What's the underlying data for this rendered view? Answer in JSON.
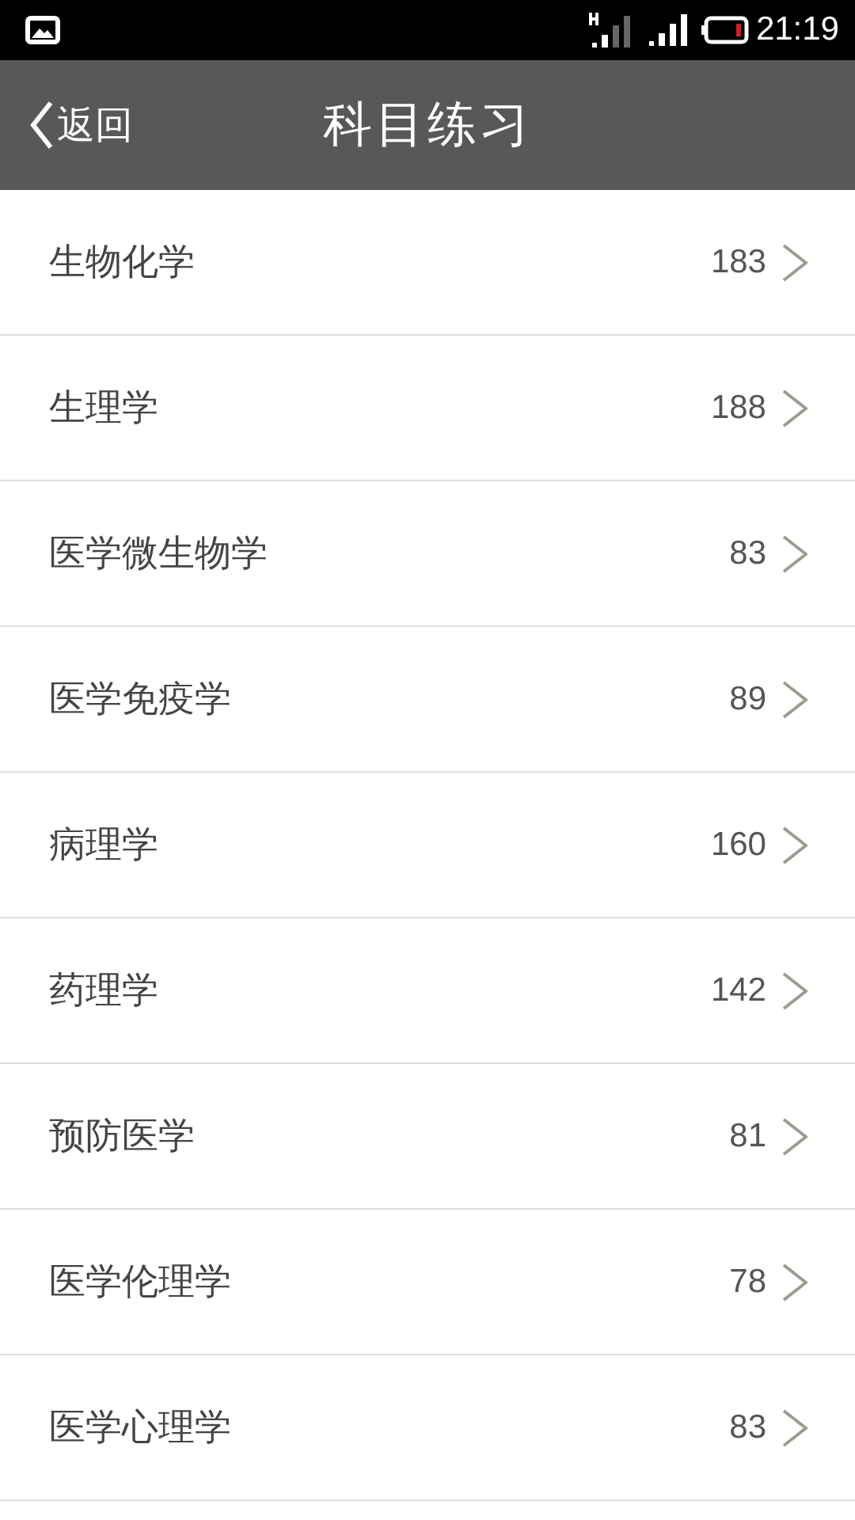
{
  "status_bar": {
    "time": "21:19"
  },
  "header": {
    "back": "返回",
    "title": "科目练习"
  },
  "subjects": [
    {
      "name": "生物化学",
      "count": "183"
    },
    {
      "name": "生理学",
      "count": "188"
    },
    {
      "name": "医学微生物学",
      "count": "83"
    },
    {
      "name": "医学免疫学",
      "count": "89"
    },
    {
      "name": "病理学",
      "count": "160"
    },
    {
      "name": "药理学",
      "count": "142"
    },
    {
      "name": "预防医学",
      "count": "81"
    },
    {
      "name": "医学伦理学",
      "count": "78"
    },
    {
      "name": "医学心理学",
      "count": "83"
    }
  ]
}
